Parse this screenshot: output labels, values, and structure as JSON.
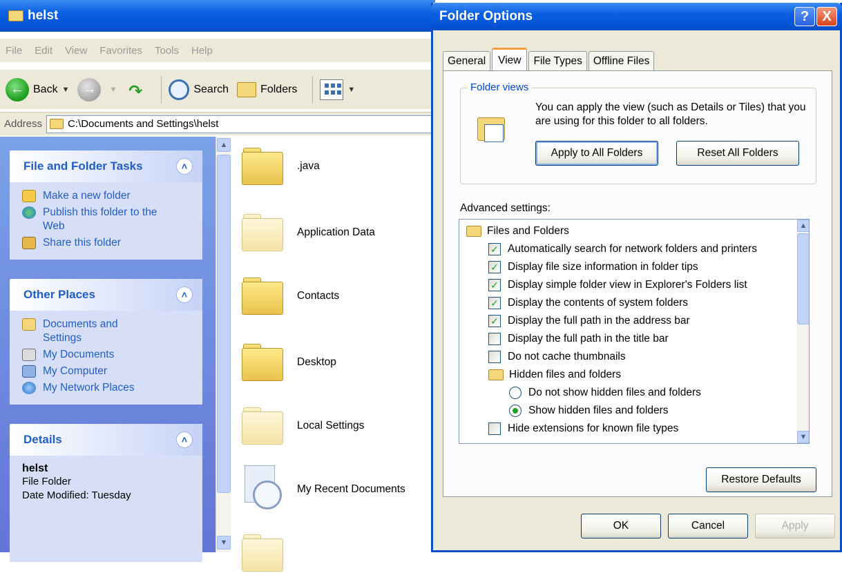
{
  "explorer": {
    "title": "helst",
    "menu": [
      "File",
      "Edit",
      "View",
      "Favorites",
      "Tools",
      "Help"
    ],
    "toolbar": {
      "back_label": "Back",
      "search_label": "Search",
      "folders_label": "Folders"
    },
    "address": {
      "label": "Address",
      "path": "C:\\Documents and Settings\\helst"
    },
    "tasks_panel": {
      "title": "File and Folder Tasks",
      "items": [
        "Make a new folder",
        "Publish this folder to the Web",
        "Share this folder"
      ]
    },
    "places_panel": {
      "title": "Other Places",
      "items": [
        "Documents and Settings",
        "My Documents",
        "My Computer",
        "My Network Places"
      ]
    },
    "details_panel": {
      "title": "Details",
      "name": "helst",
      "type": "File Folder",
      "modified": "Date Modified: Tuesday"
    },
    "files": [
      {
        "name": ".java"
      },
      {
        "name": "Application Data"
      },
      {
        "name": "Contacts"
      },
      {
        "name": "Desktop"
      },
      {
        "name": "Local Settings"
      },
      {
        "name": "My Recent Documents"
      }
    ]
  },
  "dialog": {
    "title": "Folder Options",
    "help_glyph": "?",
    "close_glyph": "X",
    "tabs": [
      "General",
      "View",
      "File Types",
      "Offline Files"
    ],
    "active_tab": "View",
    "folder_views": {
      "legend": "Folder views",
      "description": "You can apply the view (such as Details or Tiles) that you are using for this folder to all folders.",
      "apply_all_label": "Apply to All Folders",
      "reset_all_label": "Reset All Folders"
    },
    "advanced": {
      "label": "Advanced settings:",
      "group_files": "Files and Folders",
      "checkboxes": [
        {
          "label": "Automatically search for network folders and printers",
          "checked": true
        },
        {
          "label": "Display file size information in folder tips",
          "checked": true
        },
        {
          "label": "Display simple folder view in Explorer's Folders list",
          "checked": true
        },
        {
          "label": "Display the contents of system folders",
          "checked": true
        },
        {
          "label": "Display the full path in the address bar",
          "checked": true
        },
        {
          "label": "Display the full path in the title bar",
          "checked": false
        },
        {
          "label": "Do not cache thumbnails",
          "checked": false
        }
      ],
      "group_hidden": "Hidden files and folders",
      "radios": [
        {
          "label": "Do not show hidden files and folders",
          "selected": false
        },
        {
          "label": "Show hidden files and folders",
          "selected": true
        }
      ],
      "last_checkbox": {
        "label": "Hide extensions for known file types",
        "checked": false
      }
    },
    "restore_label": "Restore Defaults",
    "ok_label": "OK",
    "cancel_label": "Cancel",
    "apply_label": "Apply"
  },
  "colors": {
    "titlebar_blue": "#0a5fe0",
    "taskpane_blue": "#6375d6",
    "link_blue": "#215dc6",
    "dialog_face": "#ece9d8",
    "check_green": "#21a121"
  }
}
